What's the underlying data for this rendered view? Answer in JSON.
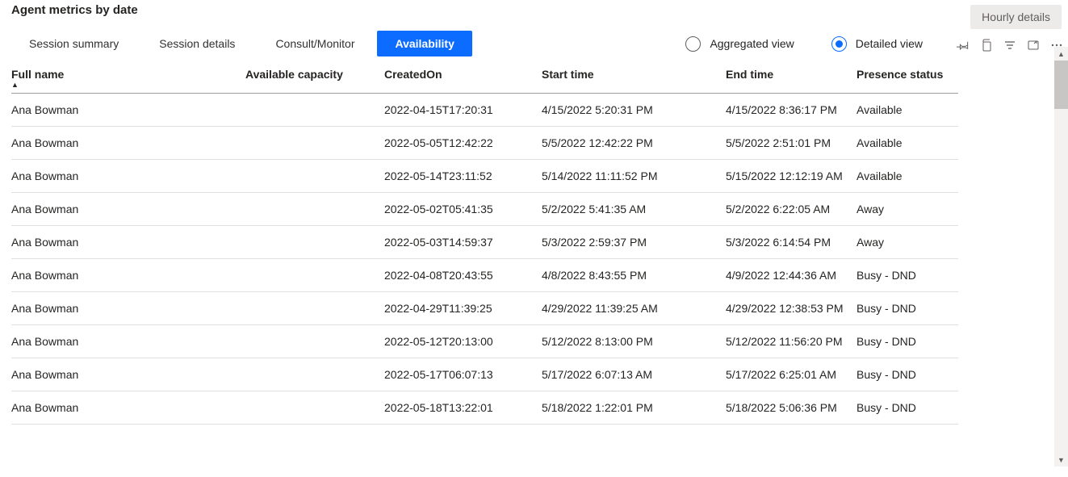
{
  "title": "Agent metrics by date",
  "tabs": [
    "Session summary",
    "Session details",
    "Consult/Monitor",
    "Availability"
  ],
  "active_tab": 3,
  "views": {
    "aggregated_label": "Aggregated view",
    "detailed_label": "Detailed view",
    "selected": "detailed"
  },
  "hourly_button": "Hourly details",
  "columns": {
    "full_name": "Full name",
    "available_capacity": "Available capacity",
    "created_on": "CreatedOn",
    "start_time": "Start time",
    "end_time": "End time",
    "presence_status": "Presence status"
  },
  "sort_column": "full_name",
  "sort_dir": "asc",
  "rows": [
    {
      "full_name": "Ana Bowman",
      "available_capacity": "",
      "created_on": "2022-04-15T17:20:31",
      "start_time": "4/15/2022 5:20:31 PM",
      "end_time": "4/15/2022 8:36:17 PM",
      "presence_status": "Available"
    },
    {
      "full_name": "Ana Bowman",
      "available_capacity": "",
      "created_on": "2022-05-05T12:42:22",
      "start_time": "5/5/2022 12:42:22 PM",
      "end_time": "5/5/2022 2:51:01 PM",
      "presence_status": "Available"
    },
    {
      "full_name": "Ana Bowman",
      "available_capacity": "",
      "created_on": "2022-05-14T23:11:52",
      "start_time": "5/14/2022 11:11:52 PM",
      "end_time": "5/15/2022 12:12:19 AM",
      "presence_status": "Available"
    },
    {
      "full_name": "Ana Bowman",
      "available_capacity": "",
      "created_on": "2022-05-02T05:41:35",
      "start_time": "5/2/2022 5:41:35 AM",
      "end_time": "5/2/2022 6:22:05 AM",
      "presence_status": "Away"
    },
    {
      "full_name": "Ana Bowman",
      "available_capacity": "",
      "created_on": "2022-05-03T14:59:37",
      "start_time": "5/3/2022 2:59:37 PM",
      "end_time": "5/3/2022 6:14:54 PM",
      "presence_status": "Away"
    },
    {
      "full_name": "Ana Bowman",
      "available_capacity": "",
      "created_on": "2022-04-08T20:43:55",
      "start_time": "4/8/2022 8:43:55 PM",
      "end_time": "4/9/2022 12:44:36 AM",
      "presence_status": "Busy - DND"
    },
    {
      "full_name": "Ana Bowman",
      "available_capacity": "",
      "created_on": "2022-04-29T11:39:25",
      "start_time": "4/29/2022 11:39:25 AM",
      "end_time": "4/29/2022 12:38:53 PM",
      "presence_status": "Busy - DND"
    },
    {
      "full_name": "Ana Bowman",
      "available_capacity": "",
      "created_on": "2022-05-12T20:13:00",
      "start_time": "5/12/2022 8:13:00 PM",
      "end_time": "5/12/2022 11:56:20 PM",
      "presence_status": "Busy - DND"
    },
    {
      "full_name": "Ana Bowman",
      "available_capacity": "",
      "created_on": "2022-05-17T06:07:13",
      "start_time": "5/17/2022 6:07:13 AM",
      "end_time": "5/17/2022 6:25:01 AM",
      "presence_status": "Busy - DND"
    },
    {
      "full_name": "Ana Bowman",
      "available_capacity": "",
      "created_on": "2022-05-18T13:22:01",
      "start_time": "5/18/2022 1:22:01 PM",
      "end_time": "5/18/2022 5:06:36 PM",
      "presence_status": "Busy - DND"
    }
  ]
}
